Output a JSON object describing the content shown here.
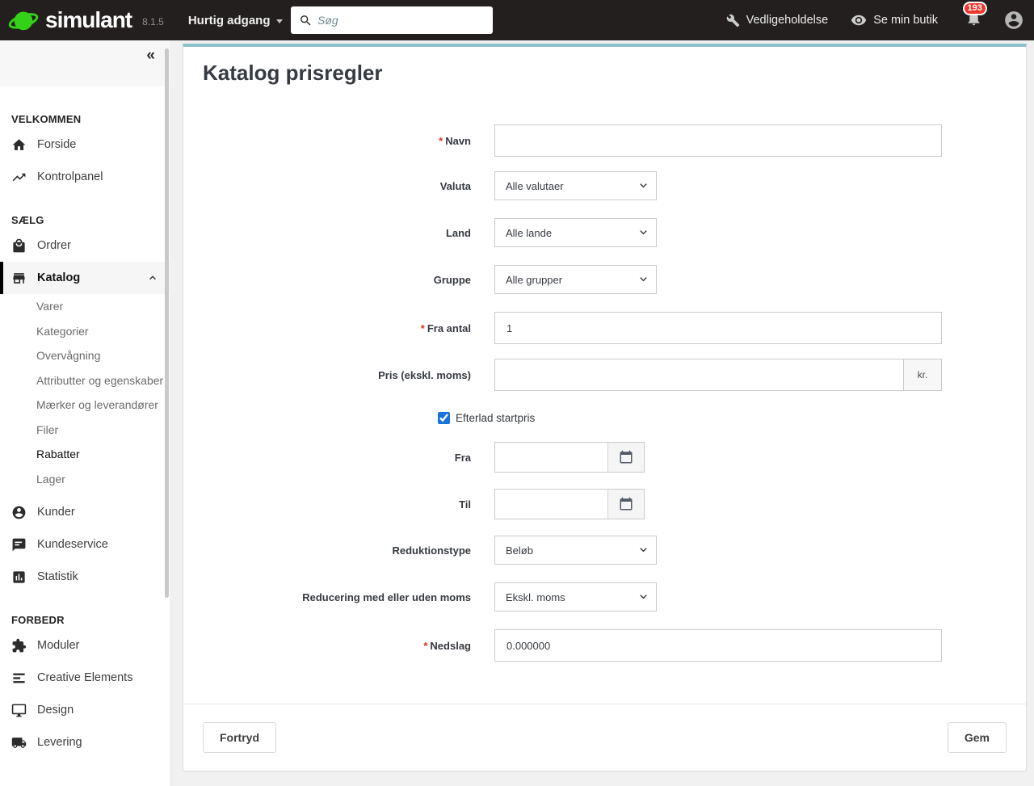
{
  "topbar": {
    "brand": "simulant",
    "version": "8.1.5",
    "quick_access_label": "Hurtig adgang",
    "search_placeholder": "Søg",
    "maintenance_label": "Vedligeholdelse",
    "view_shop_label": "Se min butik",
    "notification_count": "193"
  },
  "sidebar": {
    "collapse_icon": "«",
    "sections": [
      {
        "title": "VELKOMMEN",
        "items": [
          {
            "label": "Forside"
          },
          {
            "label": "Kontrolpanel"
          }
        ]
      },
      {
        "title": "SÆLG",
        "items": [
          {
            "label": "Ordrer"
          },
          {
            "label": "Katalog",
            "children": [
              "Varer",
              "Kategorier",
              "Overvågning",
              "Attributter og egenskaber",
              "Mærker og leverandører",
              "Filer",
              "Rabatter",
              "Lager"
            ],
            "active_child": "Rabatter"
          },
          {
            "label": "Kunder"
          },
          {
            "label": "Kundeservice"
          },
          {
            "label": "Statistik"
          }
        ]
      },
      {
        "title": "FORBEDR",
        "items": [
          {
            "label": "Moduler"
          },
          {
            "label": "Creative Elements"
          },
          {
            "label": "Design"
          },
          {
            "label": "Levering"
          }
        ]
      }
    ]
  },
  "page": {
    "title": "Katalog prisregler",
    "required_marker": "*",
    "form": {
      "navn": {
        "label": "Navn",
        "value": ""
      },
      "valuta": {
        "label": "Valuta",
        "selected": "Alle valutaer"
      },
      "land": {
        "label": "Land",
        "selected": "Alle lande"
      },
      "gruppe": {
        "label": "Gruppe",
        "selected": "Alle grupper"
      },
      "fra_antal": {
        "label": "Fra antal",
        "value": "1"
      },
      "pris": {
        "label": "Pris (ekskl. moms)",
        "value": "",
        "addon": "kr."
      },
      "efterlad": {
        "label": "Efterlad startpris",
        "state": "checked"
      },
      "fra": {
        "label": "Fra",
        "value": ""
      },
      "til": {
        "label": "Til",
        "value": ""
      },
      "reduktionstype": {
        "label": "Reduktionstype",
        "selected": "Beløb"
      },
      "reducering": {
        "label": "Reducering med eller uden moms",
        "selected": "Ekskl. moms"
      },
      "nedslag": {
        "label": "Nedslag",
        "value": "0.000000"
      }
    },
    "footer": {
      "cancel_label": "Fortryd",
      "save_label": "Gem"
    }
  },
  "colors": {
    "topbar_bg": "#231f1e",
    "logo_green": "#33d117",
    "accent_teal": "#8cc2cd",
    "checkbox_blue": "#1a74d8",
    "badge_red": "#ee372b",
    "required_red": "#e02d20"
  }
}
